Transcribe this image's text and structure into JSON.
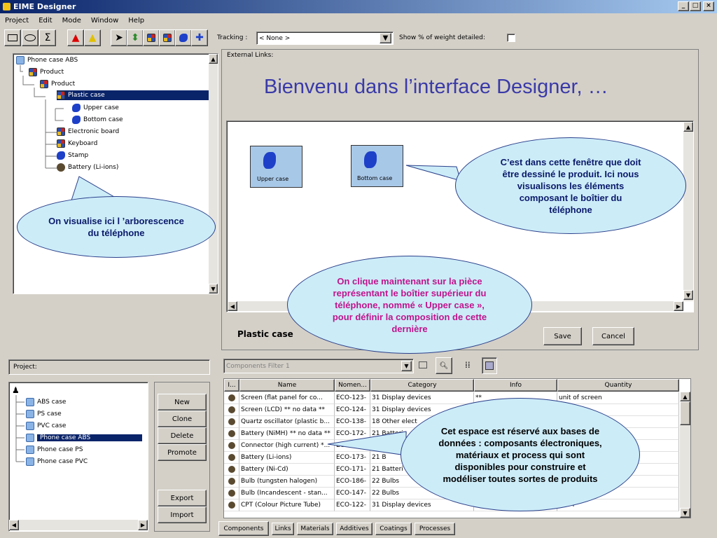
{
  "window": {
    "title": "EIME Designer"
  },
  "menu": [
    "Project",
    "Edit",
    "Mode",
    "Window",
    "Help"
  ],
  "toolbar": {
    "tracking_label": "Tracking :",
    "tracking_value": "< None >",
    "show_weight_label": "Show % of weight detailed:"
  },
  "tree": {
    "items": [
      {
        "label": "Phone case ABS",
        "icon": "folder-icon"
      },
      {
        "label": "Product",
        "icon": "product-icon"
      },
      {
        "label": "Product",
        "icon": "product-icon"
      },
      {
        "label": "Plastic case",
        "icon": "product-icon"
      },
      {
        "label": "Upper case",
        "icon": "part-icon"
      },
      {
        "label": "Bottom case",
        "icon": "part-icon"
      },
      {
        "label": "Electronic board",
        "icon": "product-icon"
      },
      {
        "label": "Keyboard",
        "icon": "product-icon"
      },
      {
        "label": "Stamp",
        "icon": "part-icon"
      },
      {
        "label": "Battery (Li-ions)",
        "icon": "battery-icon"
      }
    ]
  },
  "external_links_label": "External Links:",
  "welcome_title": "Bienvenu dans l’interface Designer, …",
  "canvas": {
    "parts": [
      {
        "label": "Upper case"
      },
      {
        "label": "Bottom case"
      }
    ]
  },
  "current_part": "Plastic case",
  "buttons": {
    "save": "Save",
    "cancel": "Cancel"
  },
  "project": {
    "label": "Project:",
    "items": [
      "ABS case",
      "PS case",
      "PVC case",
      "Phone case ABS",
      "Phone case PS",
      "Phone case PVC"
    ]
  },
  "project_buttons": {
    "new": "New",
    "clone": "Clone",
    "delete": "Delete",
    "promote": "Promote",
    "export": "Export",
    "import": "Import"
  },
  "filter": {
    "value": "Components Filter 1"
  },
  "table": {
    "columns": [
      "I...",
      "Name",
      "Nomen...",
      "Category",
      "Info",
      "Quantity"
    ],
    "rows": [
      {
        "name": "Screen (flat panel for co...",
        "nomen": "ECO-123-",
        "category": "31 Display devices",
        "info": "**",
        "qty": "unit of screen"
      },
      {
        "name": "Screen (LCD) ** no data **",
        "nomen": "ECO-124-",
        "category": "31 Display devices",
        "info": "",
        "qty": ""
      },
      {
        "name": "Quartz oscillator (plastic b...",
        "nomen": "ECO-138-",
        "category": "18 Other elect",
        "info": "",
        "qty": "illator"
      },
      {
        "name": "Battery (NiMH) ** no data **",
        "nomen": "ECO-172-",
        "category": "21 Batterie",
        "info": "",
        "qty": ""
      },
      {
        "name": "Connector (high current) *...",
        "nomen": "ECO-1",
        "category": "",
        "info": "",
        "qty": ""
      },
      {
        "name": "Battery (Li-ions)",
        "nomen": "ECO-173-",
        "category": "21 B",
        "info": "",
        "qty": ""
      },
      {
        "name": "Battery (Ni-Cd)",
        "nomen": "ECO-171-",
        "category": "21 Batteri",
        "info": "",
        "qty": ""
      },
      {
        "name": "Bulb (tungsten halogen)",
        "nomen": "ECO-186-",
        "category": "22 Bulbs",
        "info": "",
        "qty": ""
      },
      {
        "name": "Bulb (Incandescent - stan...",
        "nomen": "ECO-147-",
        "category": "22 Bulbs",
        "info": "",
        "qty": "g)"
      },
      {
        "name": "CPT (Colour Picture Tube)",
        "nomen": "ECO-122-",
        "category": "31 Display devices",
        "info": "",
        "qty": "r CPT"
      }
    ]
  },
  "tabs": [
    "Components",
    "Links",
    "Materials",
    "Additives",
    "Coatings",
    "Processes"
  ],
  "bubbles": {
    "tree": "On visualise ici l ’arborescence du téléphone",
    "canvas": "C’est dans cette fenêtre que doit être dessiné le produit. Ici nous visualisons les éléments composant le boîtier du téléphone",
    "click": "On clique maintenant sur la pièce représentant le boîtier supérieur du téléphone, nommé « Upper case », pour définir la composition de cette dernière",
    "db": "Cet espace est réservé aux bases de données : composants électroniques, matériaux et process qui sont disponibles pour construire et modéliser toutes sortes de produits"
  },
  "colors": {
    "selection": "#0a246a",
    "bubble_fill": "#ccecf8",
    "title_blue": "#3a3aa8",
    "click_text": "#c0148c"
  }
}
